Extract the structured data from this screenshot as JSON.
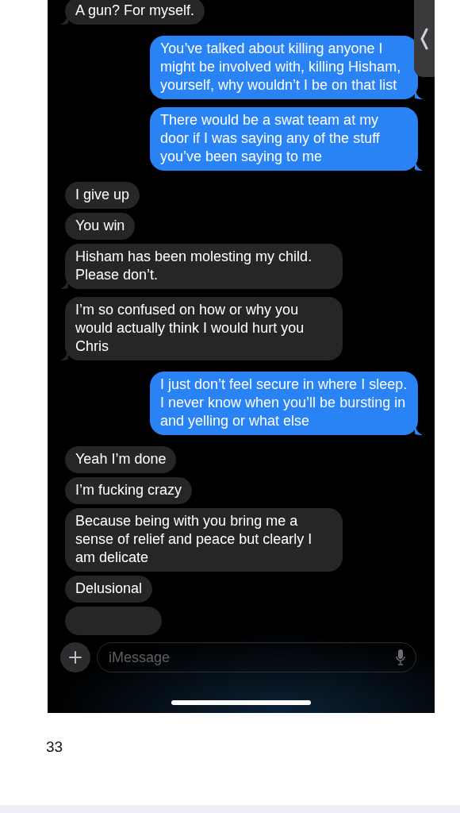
{
  "messages": [
    {
      "kind": "received",
      "text": "A gun? For myself.",
      "tail": true
    },
    {
      "kind": "sent",
      "text": "You’ve talked about killing anyone I might be involved with, killing Hisham, yourself, why wouldn’t I be on that list",
      "tail": true
    },
    {
      "kind": "sent",
      "text": "There would be a swat team at my door if I was saying any of the stuff you’ve been saying to me",
      "tail": true
    },
    {
      "kind": "received",
      "text": "I give up",
      "tail": false
    },
    {
      "kind": "received",
      "text": "You win",
      "tail": false
    },
    {
      "kind": "received",
      "text": "Hisham has been molesting my child. Please don’t.",
      "tail": true
    },
    {
      "kind": "received",
      "text": "I’m so confused on how or why you would actually think I would hurt you Chris",
      "tail": true
    },
    {
      "kind": "sent",
      "text": "I just don’t feel secure in where I sleep. I never know when you’ll be bursting in and yelling or what else",
      "tail": true
    },
    {
      "kind": "received",
      "text": "Yeah I’m done",
      "tail": false
    },
    {
      "kind": "received",
      "text": "I’m fucking crazy",
      "tail": false
    },
    {
      "kind": "received",
      "text": "Because being with you bring me a sense of relief and peace but clearly I am delicate",
      "tail": false
    },
    {
      "kind": "received",
      "text": "Delusional",
      "tail": false
    },
    {
      "kind": "received",
      "tail": false
    }
  ],
  "composer": {
    "placeholder": "iMessage"
  },
  "page_number": "33"
}
